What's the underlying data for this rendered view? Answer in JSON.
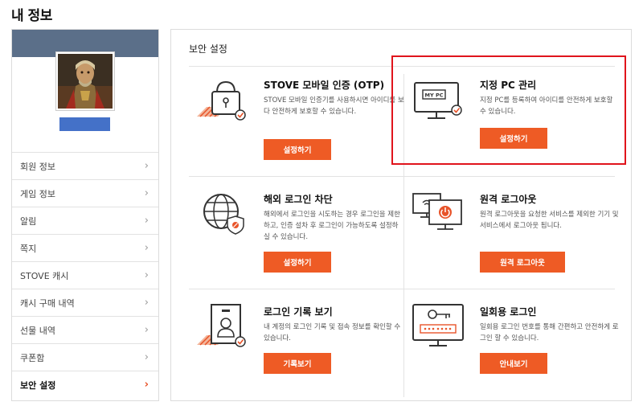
{
  "page": {
    "title": "내 정보"
  },
  "sidebar": {
    "items": [
      {
        "label": "회원 정보",
        "active": false
      },
      {
        "label": "게임 정보",
        "active": false
      },
      {
        "label": "알림",
        "active": false
      },
      {
        "label": "쪽지",
        "active": false
      },
      {
        "label": "STOVE 캐시",
        "active": false
      },
      {
        "label": "캐시 구매 내역",
        "active": false
      },
      {
        "label": "선물 내역",
        "active": false
      },
      {
        "label": "쿠폰함",
        "active": false
      },
      {
        "label": "보안 설정",
        "active": true
      }
    ],
    "chevron": "›",
    "band_color": "#5b6f89",
    "username_redaction_color": "#4471c8"
  },
  "main": {
    "section_title": "보안 설정",
    "cards": [
      {
        "id": "otp",
        "title": "STOVE 모바일 인증 (OTP)",
        "description": "STOVE 모바일 인증기를 사용하시면 아이디를 보다 안전하게 보호할 수 있습니다.",
        "button": "설정하기",
        "icon": "padlock-icon"
      },
      {
        "id": "pc",
        "title": "지정 PC 관리",
        "description": "지정 PC를 등록하여 아이디를 안전하게 보호할 수 있습니다.",
        "button": "설정하기",
        "icon": "monitor-my-pc-icon",
        "icon_label": "MY PC"
      },
      {
        "id": "overseas",
        "title": "해외 로그인 차단",
        "description": "해외에서 로그인을 시도하는 경우 로그인을 제한하고, 인증 설차 후 로그인이 가능하도록 설정하실 수 있습니다.",
        "button": "설정하기",
        "icon": "globe-shield-icon"
      },
      {
        "id": "remote",
        "title": "원격 로그아웃",
        "description": "원격 로그아웃을 요청한 서비스를 제외한 기기 및 서비스에서 로그아웃 됩니다.",
        "button": "원격 로그아웃",
        "icon": "remote-logout-icon"
      },
      {
        "id": "history",
        "title": "로그인 기록 보기",
        "description": "내 계정의 로그인 기록 및 접속 정보를 확인할 수 있습니다.",
        "button": "기록보기",
        "icon": "id-badge-icon"
      },
      {
        "id": "onetime",
        "title": "일회용 로그인",
        "description": "일회용 로그인 번호를 통해 간편하고 안전하게 로그인 할 수 있습니다.",
        "button": "안내보기",
        "icon": "key-password-icon"
      }
    ]
  },
  "colors": {
    "accent": "#ee5b25",
    "highlight_border": "#e0141c",
    "icon_stroke": "#333333"
  }
}
